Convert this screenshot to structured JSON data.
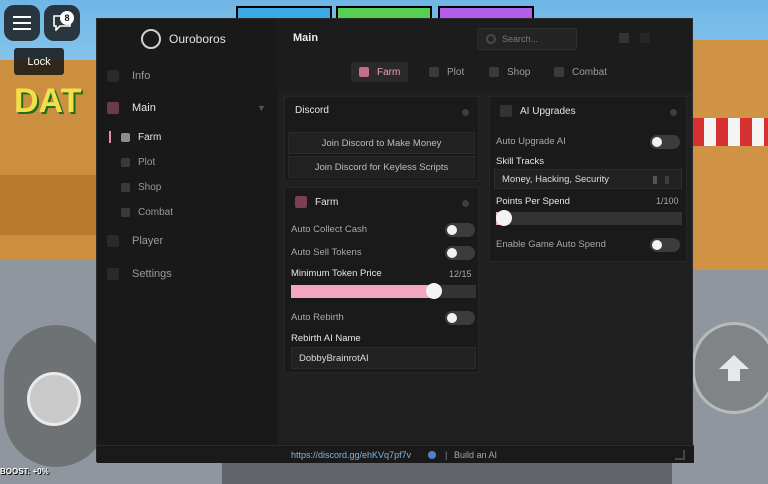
{
  "game": {
    "sign_text": "DAT",
    "chat_badge": "8",
    "lock_label": "Lock",
    "boost_text": "BOOST: +0%"
  },
  "hub": {
    "brand": "Ouroboros",
    "page_title": "Main",
    "search_placeholder": "Search...",
    "sidebar": [
      {
        "label": "Info",
        "icon": "info-icon",
        "active": false
      },
      {
        "label": "Main",
        "icon": "main-icon",
        "active": true
      },
      {
        "label": "Player",
        "icon": "player-icon",
        "active": false
      },
      {
        "label": "Settings",
        "icon": "settings-icon",
        "active": false
      }
    ],
    "subnav": [
      {
        "label": "Farm",
        "icon": "farm-icon",
        "active": true
      },
      {
        "label": "Plot",
        "icon": "plot-icon",
        "active": false
      },
      {
        "label": "Shop",
        "icon": "shop-icon",
        "active": false
      },
      {
        "label": "Combat",
        "icon": "combat-icon",
        "active": false
      }
    ],
    "tabs": [
      {
        "label": "Farm",
        "active": true
      },
      {
        "label": "Plot",
        "active": false
      },
      {
        "label": "Shop",
        "active": false
      },
      {
        "label": "Combat",
        "active": false
      }
    ],
    "discord_card": {
      "title": "Discord",
      "buttons": [
        "Join Discord to Make Money",
        "Join Discord for Keyless Scripts"
      ]
    },
    "farm_card": {
      "title": "Farm",
      "auto_collect_cash": "Auto Collect Cash",
      "auto_sell_tokens": "Auto Sell Tokens",
      "min_token_price_label": "Minimum Token Price",
      "min_token_price_value": "12/15",
      "min_token_price": 12,
      "min_token_price_max": 15,
      "auto_rebirth": "Auto Rebirth",
      "rebirth_name_label": "Rebirth AI Name",
      "rebirth_name_value": "DobbyBrainrotAI"
    },
    "ai_card": {
      "title": "AI Upgrades",
      "auto_upgrade": "Auto Upgrade AI",
      "skill_tracks_label": "Skill Tracks",
      "skill_tracks_value": "Money, Hacking, Security",
      "points_label": "Points Per Spend",
      "points_value": "1/100",
      "points": 1,
      "points_max": 100,
      "enable_auto_spend": "Enable Game Auto Spend"
    },
    "footer": {
      "link": "https://discord.gg/ehKVq7pf7v",
      "separator": "|",
      "build": "Build an AI"
    },
    "colors": {
      "accent": "#f2a7bf",
      "link": "#7fb6e0",
      "panel": "#1c1c1c"
    }
  }
}
